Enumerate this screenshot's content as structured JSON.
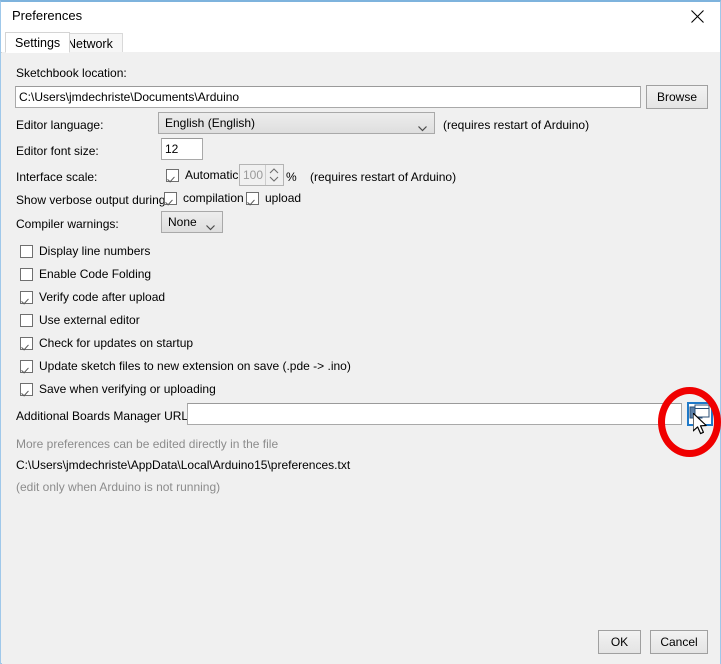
{
  "window": {
    "title": "Preferences",
    "close_icon": "close-icon"
  },
  "tabs": [
    {
      "label": "Settings",
      "active": true
    },
    {
      "label": "Network",
      "active": false
    }
  ],
  "settings": {
    "sketchbook": {
      "label": "Sketchbook location:",
      "value": "C:\\Users\\jmdechriste\\Documents\\Arduino",
      "browse_label": "Browse"
    },
    "editor_language": {
      "label": "Editor language:",
      "value": "English (English)",
      "note": "(requires restart of Arduino)"
    },
    "editor_font_size": {
      "label": "Editor font size:",
      "value": "12"
    },
    "interface_scale": {
      "label": "Interface scale:",
      "automatic_label": "Automatic",
      "automatic_checked": true,
      "scale_value": "100",
      "percent": "%",
      "note": "(requires restart of Arduino)"
    },
    "verbose_output": {
      "label": "Show verbose output during:",
      "compilation_label": "compilation",
      "compilation_checked": true,
      "upload_label": "upload",
      "upload_checked": true
    },
    "compiler_warnings": {
      "label": "Compiler warnings:",
      "value": "None"
    },
    "checkboxes": [
      {
        "label": "Display line numbers",
        "checked": false
      },
      {
        "label": "Enable Code Folding",
        "checked": false
      },
      {
        "label": "Verify code after upload",
        "checked": true
      },
      {
        "label": "Use external editor",
        "checked": false
      },
      {
        "label": "Check for updates on startup",
        "checked": true
      },
      {
        "label": "Update sketch files to new extension on save (.pde -> .ino)",
        "checked": true
      },
      {
        "label": "Save when verifying or uploading",
        "checked": true
      }
    ],
    "boards_urls": {
      "label": "Additional Boards Manager URLs:",
      "value": "",
      "expand_icon": "window-expand-icon"
    },
    "more_prefs_note": "More preferences can be edited directly in the file",
    "prefs_file_path": "C:\\Users\\jmdechriste\\AppData\\Local\\Arduino15\\preferences.txt",
    "edit_warning": "(edit only when Arduino is not running)"
  },
  "footer": {
    "ok_label": "OK",
    "cancel_label": "Cancel"
  },
  "annotation": {
    "ring_color": "#f00000",
    "cursor_icon": "mouse-pointer-icon"
  }
}
